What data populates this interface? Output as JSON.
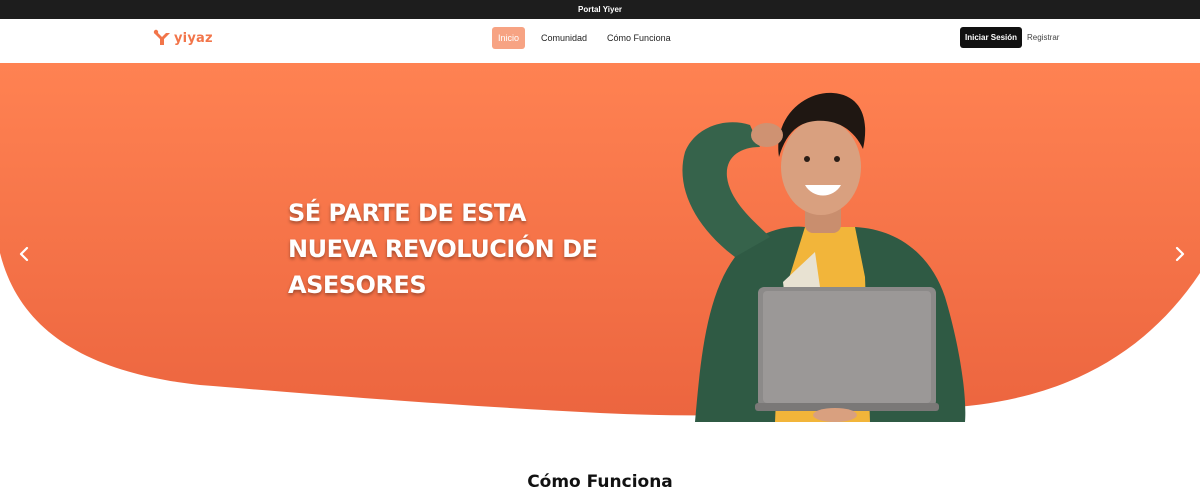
{
  "topbar": {
    "text": "Portal Yiyer"
  },
  "brand": {
    "name": "yiyaz",
    "color": "#f2754a"
  },
  "nav": {
    "links": [
      {
        "label": "Inicio",
        "active": true
      },
      {
        "label": "Comunidad",
        "active": false
      },
      {
        "label": "Cómo Funciona",
        "active": false
      }
    ],
    "login_label": "Iniciar Sesión",
    "register_label": "Registrar"
  },
  "hero": {
    "title_lines": [
      "SÉ PARTE DE ESTA",
      "NUEVA REVOLUCIÓN DE",
      "ASESORES"
    ],
    "prev_icon": "chevron-left-icon",
    "next_icon": "chevron-right-icon",
    "gradient_top": "#ff8252",
    "gradient_bottom": "#ec653f",
    "image": "smiling-man-with-laptop"
  },
  "section": {
    "title": "Cómo Funciona"
  }
}
